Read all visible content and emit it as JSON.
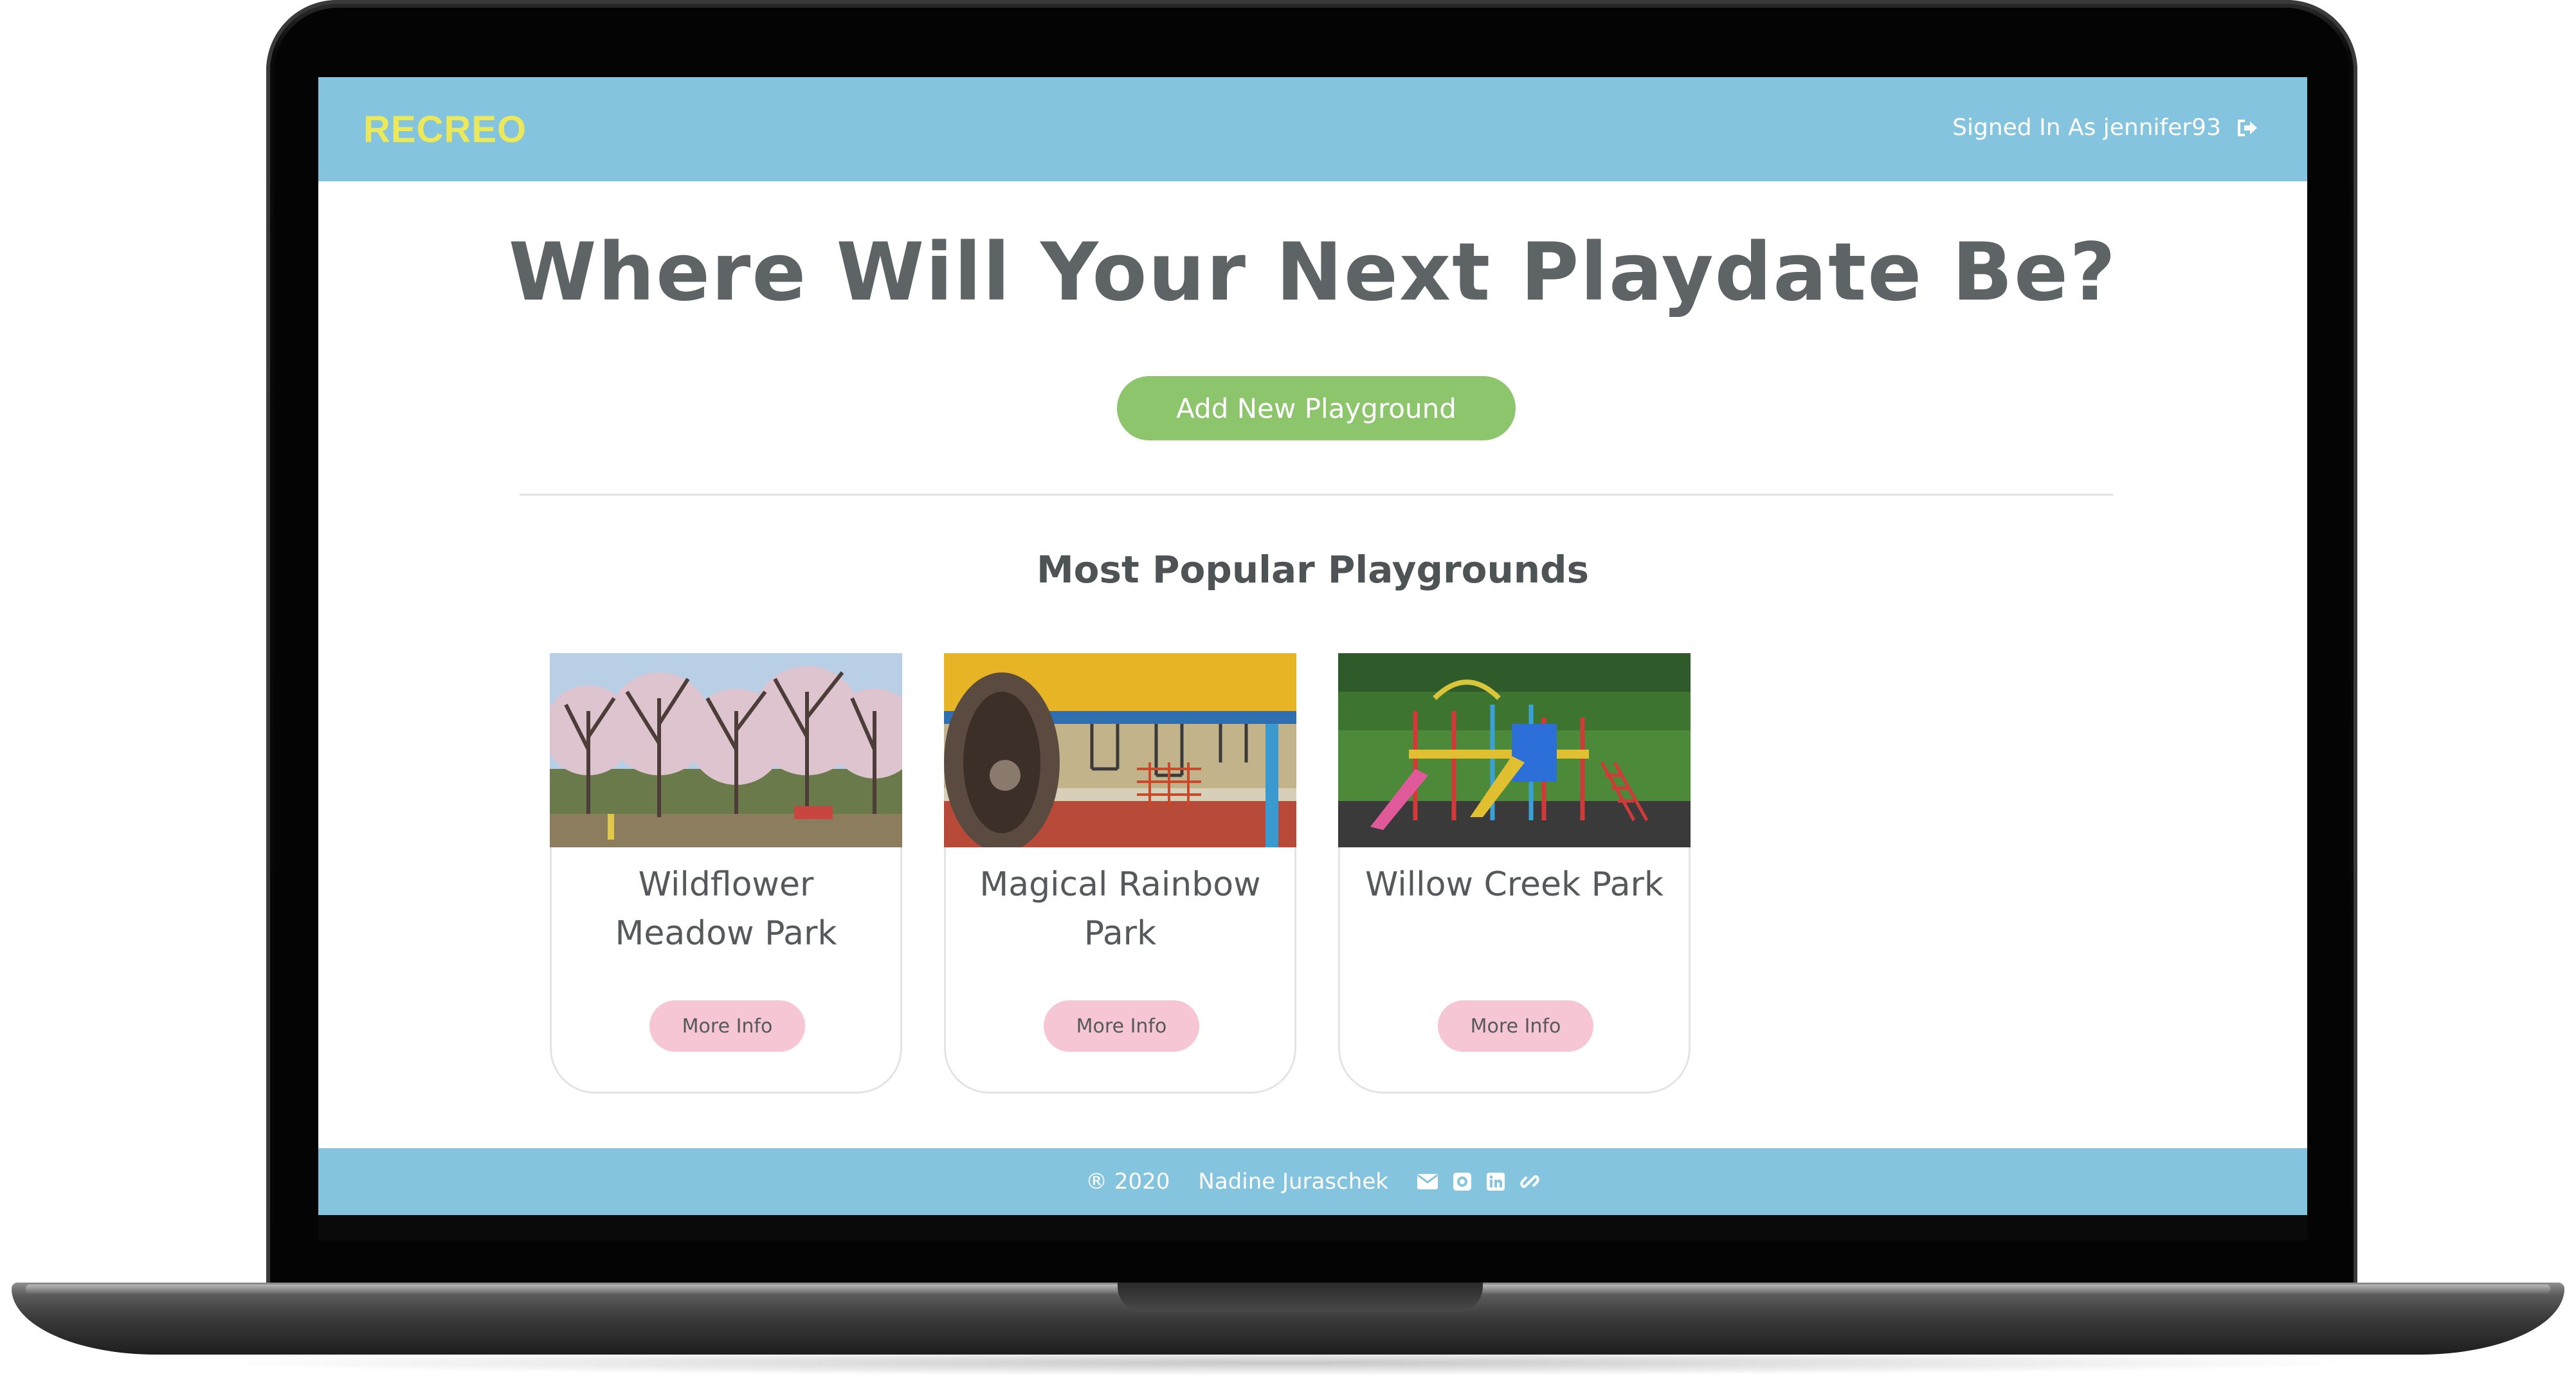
{
  "navbar": {
    "brand": "RECREO",
    "signed_in_text": "Signed In As jennifer93",
    "signout_icon": "sign-out-icon"
  },
  "hero": {
    "title": "Where Will Your Next Playdate Be?",
    "add_button_label": "Add New Playground"
  },
  "popular": {
    "heading": "Most Popular Playgrounds",
    "cards": [
      {
        "title": "Wildflower Meadow Park",
        "button_label": "More Info"
      },
      {
        "title": "Magical Rainbow Park",
        "button_label": "More Info"
      },
      {
        "title": "Willow Creek Park",
        "button_label": "More Info"
      }
    ]
  },
  "footer": {
    "copyright": "® 2020",
    "author": "Nadine Juraschek",
    "icons": [
      "envelope-icon",
      "github-icon",
      "linkedin-icon",
      "link-icon"
    ]
  },
  "colors": {
    "navbar": "#84c4df",
    "brand": "#ebe85a",
    "add_button": "#8cc56c",
    "more_button": "#f7c6d5",
    "text": "#55595b"
  }
}
